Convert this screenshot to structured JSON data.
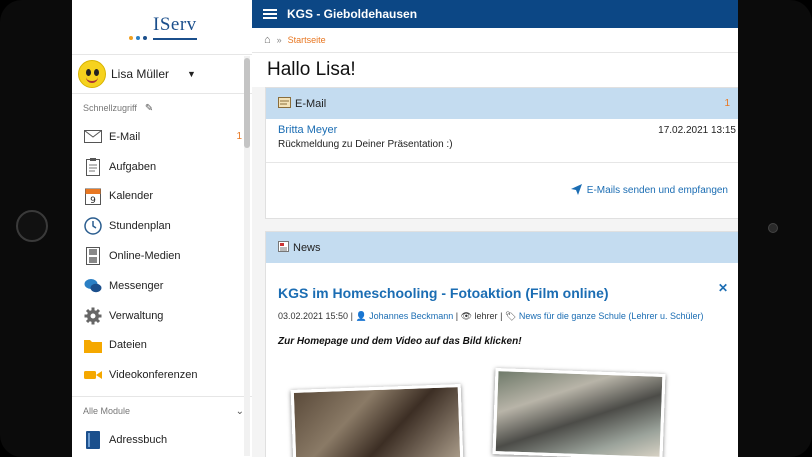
{
  "logo_text": "IServ",
  "user": {
    "name": "Lisa Müller"
  },
  "sidebar": {
    "quick_access_label": "Schnellzugriff",
    "items": [
      {
        "label": "E-Mail",
        "badge": "1",
        "icon": "envelope-icon"
      },
      {
        "label": "Aufgaben",
        "icon": "clipboard-icon"
      },
      {
        "label": "Kalender",
        "icon": "calendar-icon",
        "icon_number": "9"
      },
      {
        "label": "Stundenplan",
        "icon": "clock-icon"
      },
      {
        "label": "Online-Medien",
        "icon": "film-icon"
      },
      {
        "label": "Messenger",
        "icon": "chat-icon"
      },
      {
        "label": "Verwaltung",
        "icon": "gear-icon"
      },
      {
        "label": "Dateien",
        "icon": "folder-icon"
      },
      {
        "label": "Videokonferenzen",
        "icon": "video-camera-icon"
      }
    ],
    "all_modules_label": "Alle Module",
    "module_items": [
      {
        "label": "Adressbuch",
        "icon": "address-book-icon"
      }
    ]
  },
  "topbar": {
    "title": "KGS - Gieboldehausen"
  },
  "breadcrumb": {
    "current": "Startseite"
  },
  "greeting": "Hallo Lisa!",
  "email_panel": {
    "title": "E-Mail",
    "count": "1",
    "message": {
      "from": "Britta Meyer",
      "date": "17.02.2021 13:15",
      "subject": "Rückmeldung zu Deiner Präsentation :)"
    },
    "send_receive_label": "E-Mails senden und empfangen"
  },
  "news_panel": {
    "title": "News",
    "article": {
      "title": "KGS im Homeschooling - Fotoaktion (Film online)",
      "date": "03.02.2021 15:50",
      "author": "Johannes Beckmann",
      "role": "lehrer",
      "category": "News für die ganze Schule (Lehrer u. Schüler)",
      "description": "Zur Homepage und dem Video auf das Bild klicken!"
    }
  },
  "colors": {
    "topbar": "#0c4785",
    "accent_blue": "#1b6db3",
    "badge_orange": "#e87722",
    "panel_header": "#c4dcf0"
  }
}
